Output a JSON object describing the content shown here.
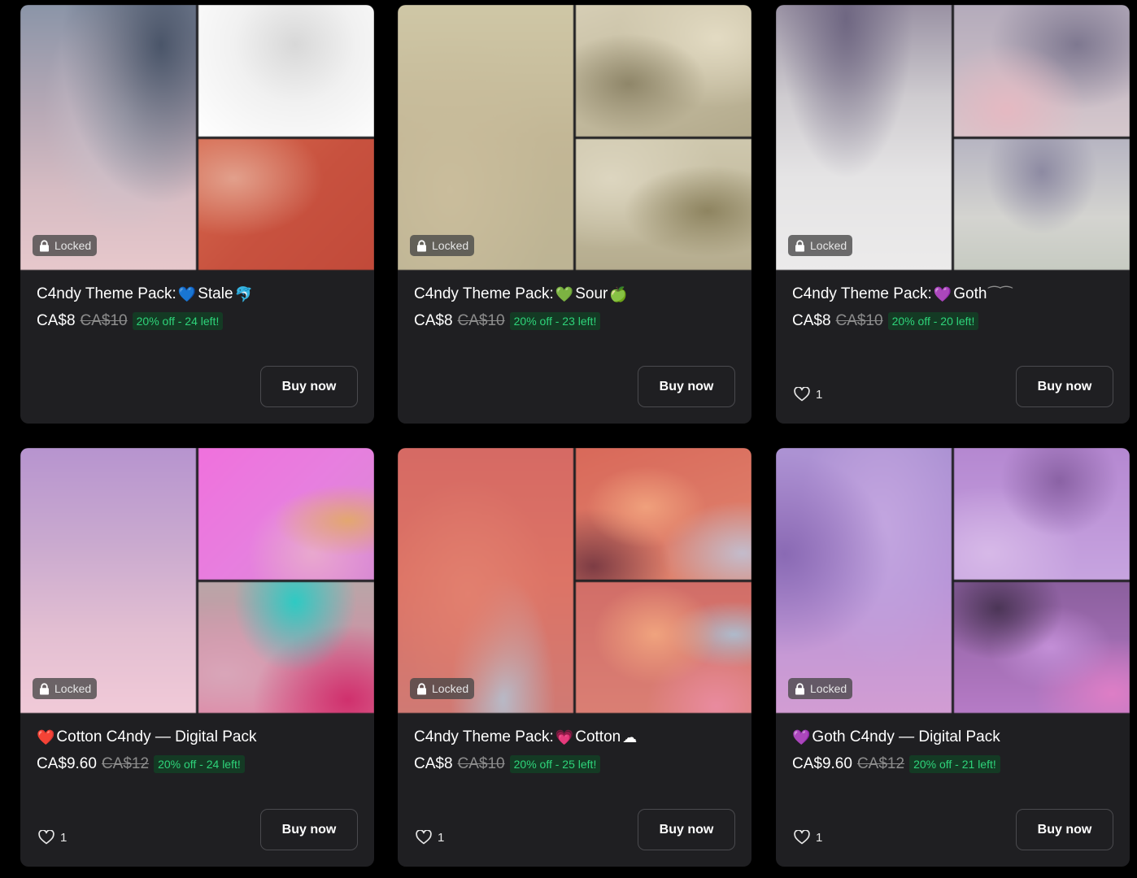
{
  "cards": [
    {
      "locked_label": "Locked",
      "title_parts": [
        {
          "t": "text",
          "v": "C4ndy Theme Pack:"
        },
        {
          "t": "emoji",
          "v": "💙",
          "c": "#4fb8e8"
        },
        {
          "t": "text",
          "v": "Stale"
        },
        {
          "t": "emoji",
          "v": "🐬",
          "c": "#5ab0e6"
        }
      ],
      "price": "CA$8",
      "old_price": "CA$10",
      "discount": "20% off - 24 left!",
      "likes": "",
      "buy_label": "Buy now",
      "tiles": {
        "big": "radial-gradient(ellipse at 80% 15%, #4a5569 0%, transparent 50%), radial-gradient(ellipse at 60% 40%, #c9c2cc 0%, transparent 55%), linear-gradient(180deg, #8b95a8 0%, #b7a9b6 40%, #d6bcc3 70%, #e7c8cc 100%)",
        "tr": "radial-gradient(ellipse at 55% 30%, #d8d8d8 0%, #f1f1f1 45%, #ffffff 100%)",
        "br": "radial-gradient(ellipse at 20% 30%, #e2a08c 0%, transparent 45%), linear-gradient(135deg, #d7684d 0%, #c8523f 50%, #c24a3a 100%)"
      }
    },
    {
      "locked_label": "Locked",
      "title_parts": [
        {
          "t": "text",
          "v": "C4ndy Theme Pack:"
        },
        {
          "t": "emoji",
          "v": "💚",
          "c": "#3ec85a"
        },
        {
          "t": "text",
          "v": "Sour"
        },
        {
          "t": "emoji",
          "v": "🍏",
          "c": "#6cc43a"
        }
      ],
      "price": "CA$8",
      "old_price": "CA$10",
      "discount": "20% off - 23 left!",
      "likes": "",
      "buy_label": "Buy now",
      "tiles": {
        "big": "radial-gradient(ellipse at 30% 70%, #cabd9c 0%, transparent 60%), linear-gradient(180deg, #cfc7a6 0%, #c3b796 50%, #bdb494 100%)",
        "tr": "radial-gradient(ellipse at 30% 60%, #8f8669 0%, transparent 45%), radial-gradient(ellipse at 80% 25%, #e3dbc3 0%, transparent 50%), linear-gradient(160deg, #d6ceb5 0%, #b3aa8c 100%)",
        "br": "radial-gradient(ellipse at 75% 55%, #8e8460 0%, transparent 45%), radial-gradient(ellipse at 20% 30%, #ddd6c0 0%, transparent 55%), linear-gradient(180deg, #cfc8ae 0%, #b5ac8e 100%)"
      }
    },
    {
      "locked_label": "Locked",
      "title_parts": [
        {
          "t": "text",
          "v": "C4ndy Theme Pack:"
        },
        {
          "t": "emoji",
          "v": "💜",
          "c": "#a257e8"
        },
        {
          "t": "text",
          "v": "Goth"
        },
        {
          "t": "emoji",
          "v": "⁀⁀",
          "c": "#8d8d8d"
        }
      ],
      "price": "CA$8",
      "old_price": "CA$10",
      "discount": "20% off - 20 left!",
      "likes": "1",
      "buy_label": "Buy now",
      "tiles": {
        "big": "radial-gradient(ellipse at 40% 5%, #6f6782 0%, transparent 45%), linear-gradient(180deg, #9a92a4 0%, #cfccd0 35%, #e5e4e5 65%, #ecebeb 100%)",
        "tr": "radial-gradient(ellipse at 30% 80%, #e5b9c2 0%, transparent 45%), radial-gradient(ellipse at 70% 30%, #7e7890 0%, transparent 50%), linear-gradient(180deg, #b4abbb 0%, #d6c8cd 100%)",
        "br": "radial-gradient(ellipse at 50% 25%, #8d8aa2 0%, transparent 45%), linear-gradient(180deg, #b7b5c2 0%, #d4d4d0 60%, #c7cbc2 100%)"
      }
    },
    {
      "locked_label": "Locked",
      "title_parts": [
        {
          "t": "emoji",
          "v": "❤️",
          "c": "#e8333f"
        },
        {
          "t": "text",
          "v": "Cotton C4ndy — Digital Pack"
        }
      ],
      "price": "CA$9.60",
      "old_price": "CA$12",
      "discount": "20% off - 24 left!",
      "likes": "1",
      "buy_label": "Buy now",
      "tiles": {
        "big": "linear-gradient(180deg, #b794cf 0%, #c9a9cf 35%, #e3bfd2 70%, #f1cad8 100%)",
        "tr": "radial-gradient(ellipse at 85% 55%, #e3a770 0%, transparent 35%), radial-gradient(ellipse at 65% 80%, #e9a8ce 0%, transparent 40%), linear-gradient(135deg, #f071dd 0%, #e77fdf 50%, #d88bd3 100%)",
        "br": "radial-gradient(ellipse at 55% 15%, #2ecac3 0%, transparent 45%), radial-gradient(ellipse at 85% 90%, #d0306d 0%, transparent 45%), radial-gradient(ellipse at 15% 70%, #d9a6b9 0%, transparent 55%), linear-gradient(180deg, #b9a6a8 0%, #e07fa1 100%)"
      }
    },
    {
      "locked_label": "Locked",
      "title_parts": [
        {
          "t": "text",
          "v": "C4ndy Theme Pack:"
        },
        {
          "t": "emoji",
          "v": "💗",
          "c": "#ff5fb0"
        },
        {
          "t": "text",
          "v": "Cotton"
        },
        {
          "t": "emoji",
          "v": "☁",
          "c": "#ffffff"
        }
      ],
      "price": "CA$8",
      "old_price": "CA$10",
      "discount": "20% off - 25 left!",
      "likes": "1",
      "buy_label": "Buy now",
      "tiles": {
        "big": "radial-gradient(ellipse at 40% 55%, #e2806f 0%, transparent 55%), radial-gradient(ellipse at 60% 95%, #b8b9c6 0%, transparent 35%), linear-gradient(180deg, #d66a64 0%, #dd7466 50%, #d07a74 100%)",
        "tr": "radial-gradient(ellipse at 40% 45%, #f0a07c 0%, transparent 40%), radial-gradient(ellipse at 10% 90%, #7d3c44 0%, transparent 35%), radial-gradient(ellipse at 95% 80%, #c3bccc 0%, transparent 35%), linear-gradient(160deg, #d9695a 0%, #e08670 100%)",
        "br": "radial-gradient(ellipse at 45% 40%, #f0a37e 0%, transparent 45%), radial-gradient(ellipse at 90% 40%, #aebacb 0%, transparent 30%), radial-gradient(ellipse at 80% 95%, #e98b9f 0%, transparent 35%), linear-gradient(180deg, #d26e68 0%, #da7f74 100%)"
      }
    },
    {
      "locked_label": "Locked",
      "title_parts": [
        {
          "t": "emoji",
          "v": "💜",
          "c": "#a257e8"
        },
        {
          "t": "text",
          "v": "Goth C4ndy — Digital Pack"
        }
      ],
      "price": "CA$9.60",
      "old_price": "CA$12",
      "discount": "20% off - 21 left!",
      "likes": "1",
      "buy_label": "Buy now",
      "tiles": {
        "big": "radial-gradient(ellipse at 5% 40%, #8a6ab4 0%, transparent 45%), radial-gradient(ellipse at 60% 30%, #c3a6e0 0%, transparent 55%), linear-gradient(180deg, #ac92d3 0%, #b895d8 50%, #d29dd3 100%)",
        "tr": "radial-gradient(ellipse at 60% 25%, #8a62a4 0%, transparent 40%), radial-gradient(ellipse at 20% 80%, #d7b9e8 0%, transparent 45%), linear-gradient(180deg, #b588d1 0%, #c7a4e0 100%)",
        "br": "radial-gradient(ellipse at 25% 20%, #4b3556 0%, transparent 35%), radial-gradient(ellipse at 55% 50%, #c38fd7 0%, transparent 45%), radial-gradient(ellipse at 90% 85%, #de7ec6 0%, transparent 35%), linear-gradient(180deg, #8b5f9e 0%, #b67bc6 100%)"
      }
    }
  ]
}
